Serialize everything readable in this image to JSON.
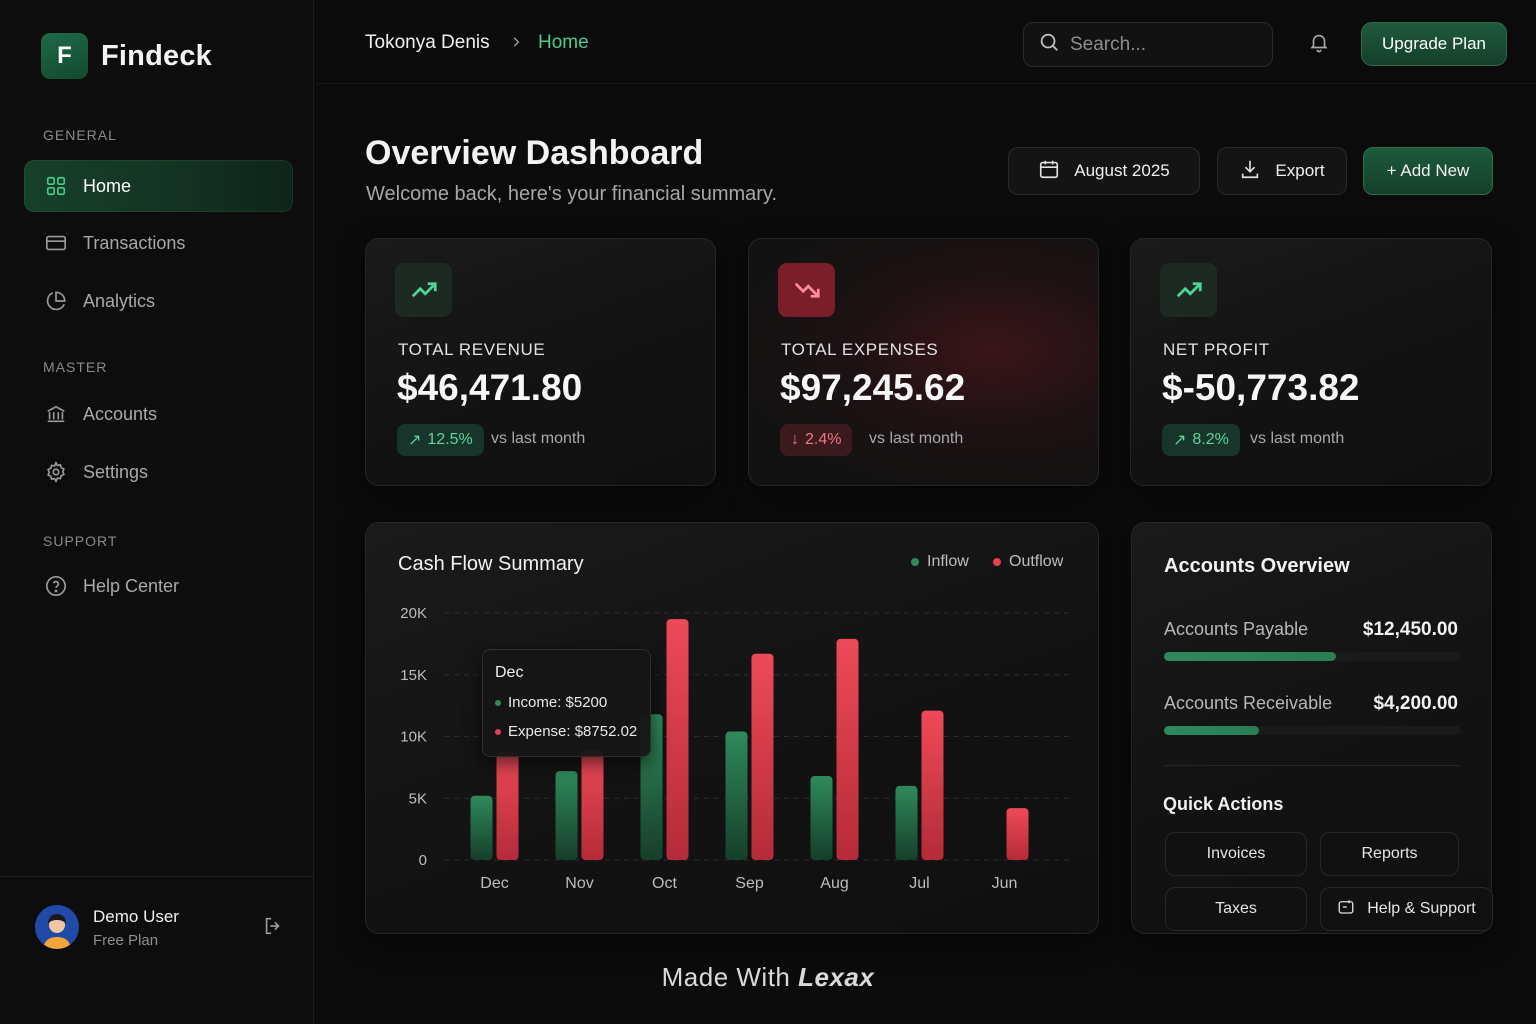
{
  "app": {
    "name": "Findeck",
    "logo_letter": "F"
  },
  "sidebar": {
    "sections": [
      {
        "label": "GENERAL",
        "items": [
          {
            "label": "Home",
            "icon": "grid-icon",
            "active": true
          },
          {
            "label": "Transactions",
            "icon": "card-icon"
          },
          {
            "label": "Analytics",
            "icon": "pie-chart-icon"
          }
        ]
      },
      {
        "label": "MASTER",
        "items": [
          {
            "label": "Accounts",
            "icon": "bank-icon"
          },
          {
            "label": "Settings",
            "icon": "gear-icon"
          }
        ]
      },
      {
        "label": "SUPPORT",
        "items": [
          {
            "label": "Help Center",
            "icon": "help-circle-icon"
          }
        ]
      }
    ],
    "user": {
      "name": "Demo User",
      "plan": "Free Plan"
    }
  },
  "topbar": {
    "breadcrumb": {
      "parent": "Tokonya Denis",
      "current": "Home"
    },
    "search_placeholder": "Search...",
    "upgrade_label": "Upgrade Plan"
  },
  "header": {
    "title": "Overview Dashboard",
    "subtitle": "Welcome back, here's your financial summary.",
    "date_label": "August 2025",
    "export_label": "Export",
    "add_label": "+ Add New"
  },
  "stats": [
    {
      "label": "TOTAL REVENUE",
      "value": "$46,471.80",
      "change": "12.5%",
      "trend": "up",
      "vs": "vs last month"
    },
    {
      "label": "TOTAL EXPENSES",
      "value": "$97,245.62",
      "change": "2.4%",
      "trend": "down",
      "vs": "vs last month"
    },
    {
      "label": "NET PROFIT",
      "value": "$-50,773.82",
      "change": "8.2%",
      "trend": "up",
      "vs": "vs last month"
    }
  ],
  "chart_data": {
    "type": "bar",
    "title": "Cash Flow Summary",
    "categories": [
      "Dec",
      "Nov",
      "Oct",
      "Sep",
      "Aug",
      "Jul",
      "Jun"
    ],
    "series": [
      {
        "name": "Inflow",
        "color": "#2f8a5b",
        "values": [
          5200,
          7200,
          11800,
          10400,
          6800,
          6000,
          0
        ]
      },
      {
        "name": "Outflow",
        "color": "#e5404f",
        "values": [
          8752.02,
          8900,
          19500,
          16700,
          17900,
          12100,
          4200
        ]
      }
    ],
    "y_ticks": [
      "0",
      "5K",
      "10K",
      "15K",
      "20K"
    ],
    "ylim": [
      0,
      20000
    ],
    "legend_position": "top-right",
    "grid": true,
    "tooltip": {
      "title": "Dec",
      "income": "Income: $5200",
      "expense": "Expense: $8752.02"
    }
  },
  "accounts": {
    "title": "Accounts Overview",
    "rows": [
      {
        "label": "Accounts Payable",
        "value": "$12,450.00",
        "fill": 0.58
      },
      {
        "label": "Accounts Receivable",
        "value": "$4,200.00",
        "fill": 0.32
      }
    ],
    "quick_actions_title": "Quick Actions",
    "quick_actions": [
      "Invoices",
      "Reports",
      "Taxes",
      "Help & Support"
    ]
  },
  "footer": {
    "prefix": "Made With",
    "brand": "Lexax"
  },
  "colors": {
    "accent": "#4cc98c",
    "danger": "#e5404f",
    "background": "#0b0b0b"
  }
}
